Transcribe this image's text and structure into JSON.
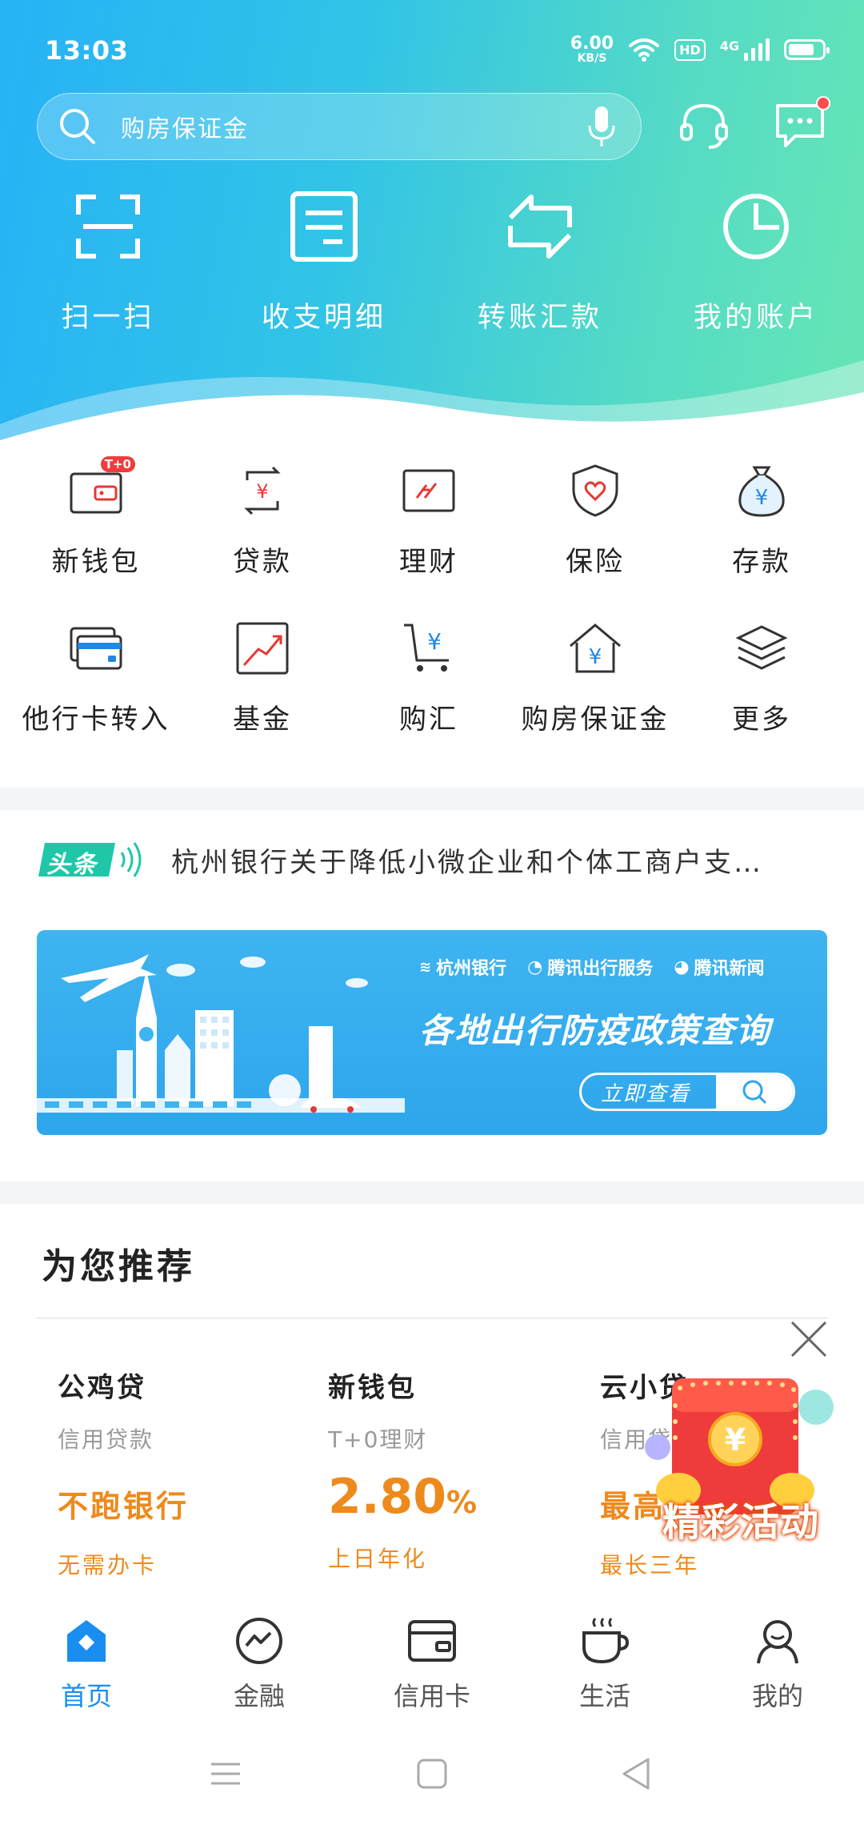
{
  "status": {
    "time": "13:03",
    "net_speed": "6.00",
    "net_unit": "KB/S",
    "hd": "HD",
    "signal_label": "4G"
  },
  "search": {
    "placeholder": "购房保证金"
  },
  "quick_actions": [
    {
      "label": "扫一扫",
      "icon": "scan-icon"
    },
    {
      "label": "收支明细",
      "icon": "statement-icon"
    },
    {
      "label": "转账汇款",
      "icon": "transfer-icon"
    },
    {
      "label": "我的账户",
      "icon": "account-pie-icon"
    }
  ],
  "services": [
    {
      "label": "新钱包",
      "icon": "wallet-icon",
      "badge": "T+0"
    },
    {
      "label": "贷款",
      "icon": "loan-icon"
    },
    {
      "label": "理财",
      "icon": "wealth-icon"
    },
    {
      "label": "保险",
      "icon": "insurance-shield-icon"
    },
    {
      "label": "存款",
      "icon": "deposit-bag-icon"
    },
    {
      "label": "他行卡转入",
      "icon": "card-transfer-icon"
    },
    {
      "label": "基金",
      "icon": "fund-chart-icon"
    },
    {
      "label": "购汇",
      "icon": "fx-cart-icon"
    },
    {
      "label": "购房保证金",
      "icon": "house-deposit-icon"
    },
    {
      "label": "更多",
      "icon": "more-layers-icon"
    }
  ],
  "headline": {
    "tag": "头条",
    "text": "杭州银行关于降低小微企业和个体工商户支…"
  },
  "banner": {
    "logo1": "杭州银行",
    "logo2": "腾讯出行服务",
    "logo3": "腾讯新闻",
    "title": "各地出行防疫政策查询",
    "button": "立即查看"
  },
  "recommend": {
    "title": "为您推荐",
    "items": [
      {
        "name": "公鸡贷",
        "sub": "信用贷款",
        "highlight": "不跑银行",
        "foot": "无需办卡"
      },
      {
        "name": "新钱包",
        "sub": "T+0理财",
        "highlight": "2.80",
        "highlight_unit": "%",
        "foot": "上日年化"
      },
      {
        "name": "云小贷",
        "sub": "信用贷",
        "highlight": "最高",
        "foot": "最长三年"
      }
    ],
    "promo_label": "精彩活动"
  },
  "tabs": [
    {
      "label": "首页",
      "icon": "home-icon",
      "active": true
    },
    {
      "label": "金融",
      "icon": "finance-icon"
    },
    {
      "label": "信用卡",
      "icon": "credit-card-icon"
    },
    {
      "label": "生活",
      "icon": "coffee-cup-icon"
    },
    {
      "label": "我的",
      "icon": "profile-icon"
    }
  ],
  "colors": {
    "accent": "#1a8ef0",
    "gradient_start": "#27b2f6",
    "gradient_end": "#66e6b4",
    "highlight_orange": "#ee8a1c",
    "icon_red": "#e53935"
  }
}
